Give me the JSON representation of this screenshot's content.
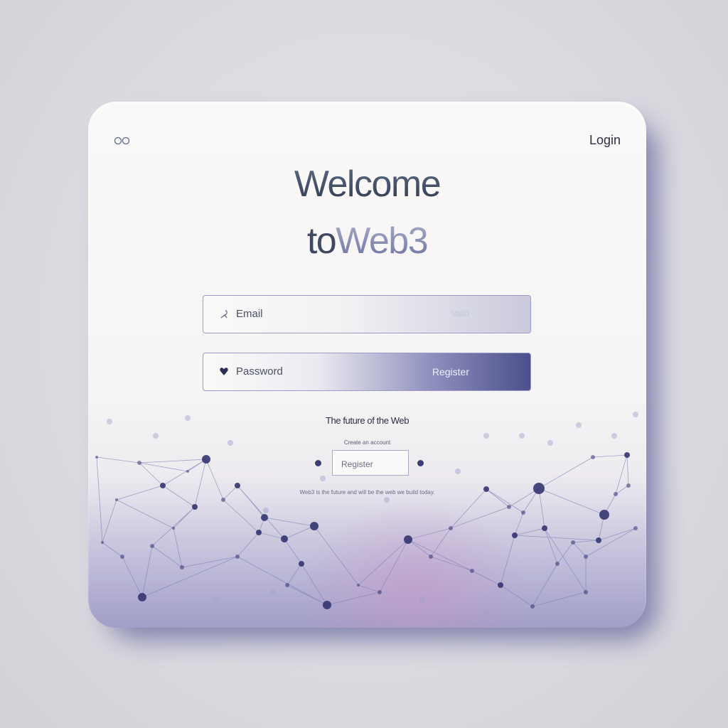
{
  "header": {
    "menu_icon": "two-circles-icon",
    "login_label": "Login"
  },
  "hero": {
    "title_line1": "Welcome",
    "title_line2_a": "to",
    "title_line2_b": "Web3"
  },
  "form": {
    "email": {
      "icon": "user-icon",
      "placeholder": "Email",
      "right_text": "Valid"
    },
    "password": {
      "icon": "heart-icon",
      "placeholder": "Password",
      "right_text": "Register"
    }
  },
  "promo": {
    "tagline": "The future of the Web",
    "caption": "Create an account",
    "register_label": "Register",
    "footer_note": "Web3 is the future and will be the web we build today."
  },
  "colors": {
    "accent": "#4c4f8c",
    "network_node": "#34356f",
    "text_dark": "#2b2e47"
  }
}
